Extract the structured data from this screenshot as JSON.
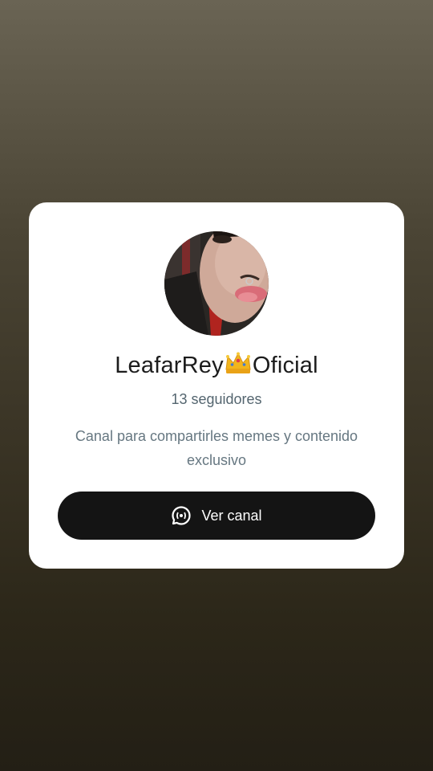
{
  "channel": {
    "name_prefix": "LeafarRey",
    "crown_icon": "crown-icon",
    "name_suffix": "Oficial",
    "followers": "13 seguidores",
    "description": "Canal para compartirles memes y contenido exclusivo"
  },
  "cta": {
    "label": "Ver canal",
    "icon": "channel-chat-icon"
  },
  "colors": {
    "card_background": "#ffffff",
    "button_background": "#141414",
    "button_text": "#ffffff",
    "title_text": "#1c1c1c",
    "muted_text": "#667781"
  }
}
